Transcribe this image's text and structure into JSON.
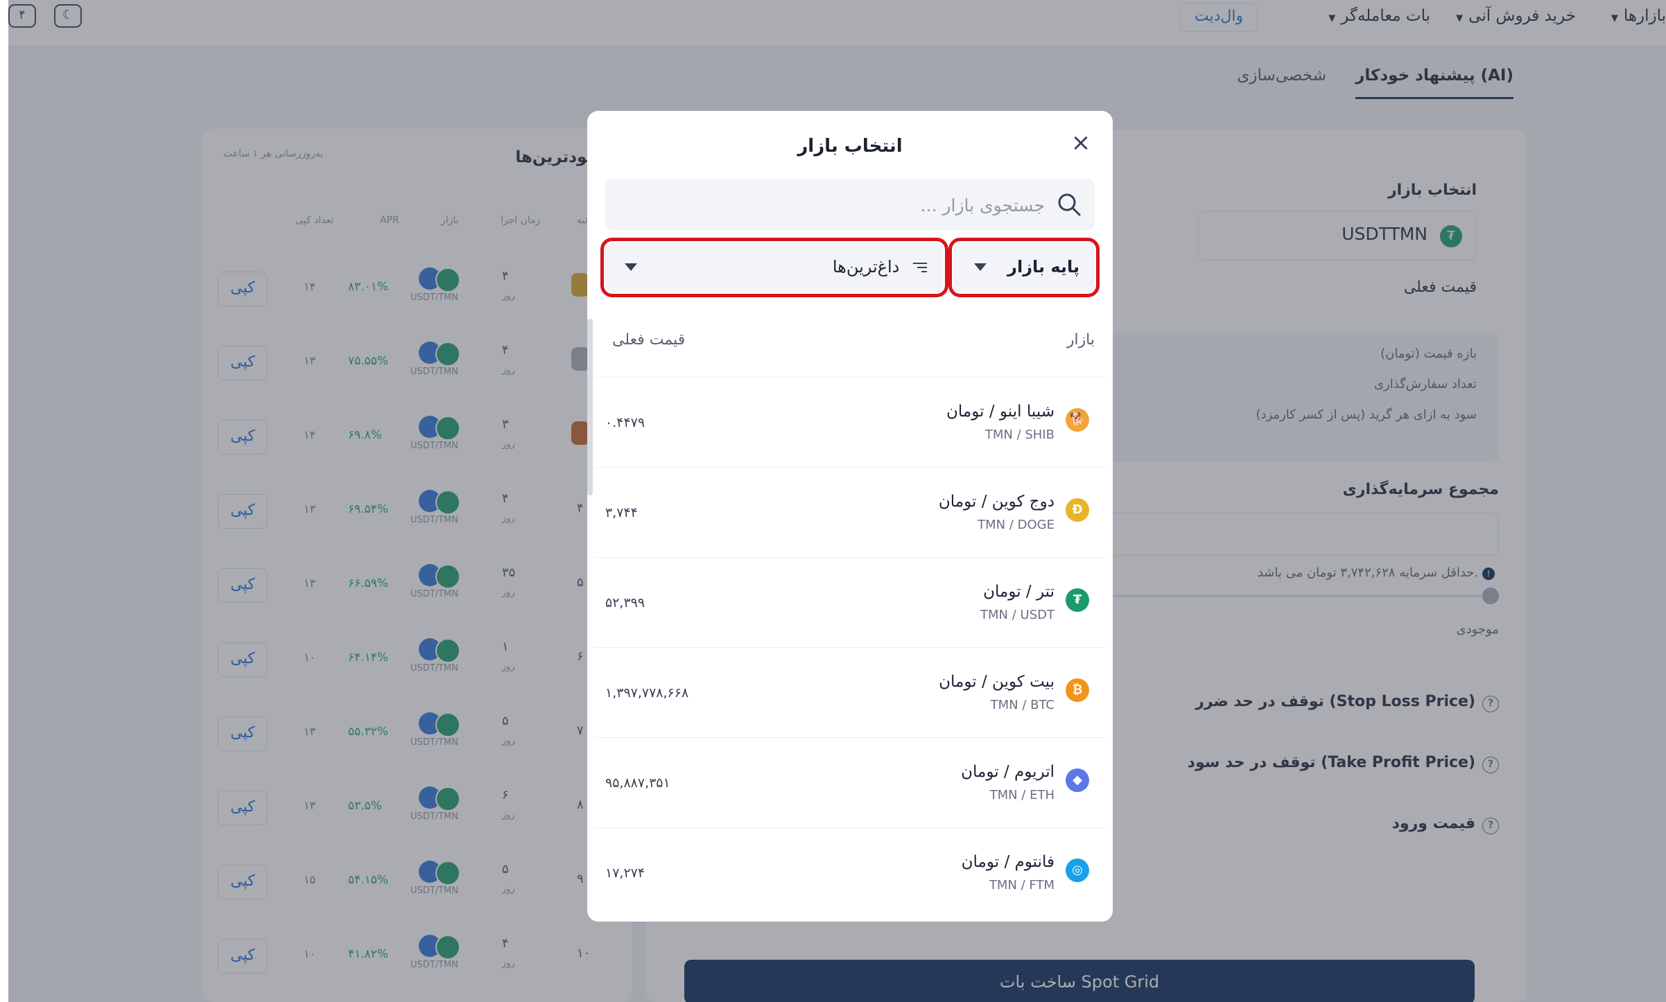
{
  "topnav": {
    "markets": "بازارها",
    "instant_trade": "خرید فروش آنی",
    "trading_bot": "بات معامله‌گر",
    "update": "وال‌دیت"
  },
  "tabs": {
    "ai": "پیشنهاد خودکار (AI)",
    "custom": "شخصی‌سازی"
  },
  "leftpanel": {
    "title": "پرسودترین‌ها",
    "update_note": "به‌روزرسانی هر ۱ ساعت",
    "headers": {
      "rank": "رتبه",
      "runtime": "زمان اجرا",
      "market": "بازار",
      "apr": "APR",
      "copies": "تعداد کپی"
    },
    "copy_label": "کپی",
    "day_unit": "روز",
    "rows": [
      {
        "rank": "",
        "runtime": "۴",
        "pair": "USDT/TMN",
        "apr": "۸۳.۰۱%",
        "copies": "۱۴"
      },
      {
        "rank": "",
        "runtime": "۴",
        "pair": "USDT/TMN",
        "apr": "۷۵.۵۵%",
        "copies": "۱۳"
      },
      {
        "rank": "",
        "runtime": "۳",
        "pair": "USDT/TMN",
        "apr": "۶۹.۸%",
        "copies": "۱۴"
      },
      {
        "rank": "۴",
        "runtime": "۴",
        "pair": "USDT/TMN",
        "apr": "۶۹.۵۴%",
        "copies": "۱۳"
      },
      {
        "rank": "۵",
        "runtime": "۳۵",
        "pair": "USDT/TMN",
        "apr": "۶۶.۵۹%",
        "copies": "۱۳"
      },
      {
        "rank": "۶",
        "runtime": "۱",
        "pair": "USDT/TMN",
        "apr": "۶۴.۱۴%",
        "copies": "۱۰"
      },
      {
        "rank": "۷",
        "runtime": "۵",
        "pair": "USDT/TMN",
        "apr": "۵۵.۳۲%",
        "copies": "۱۳"
      },
      {
        "rank": "۸",
        "runtime": "۶",
        "pair": "USDT/TMN",
        "apr": "۵۳.۵%",
        "copies": "۱۳"
      },
      {
        "rank": "۹",
        "runtime": "۵",
        "pair": "USDT/TMN",
        "apr": "۵۴.۱۵%",
        "copies": "۱۵"
      },
      {
        "rank": "۱۰",
        "runtime": "۴",
        "pair": "USDT/TMN",
        "apr": "۴۱.۸۲%",
        "copies": "۱۰"
      }
    ]
  },
  "form": {
    "select_market": "انتخاب بازار",
    "selected_market": "USDTTMN",
    "current_price": "قیمت فعلی",
    "price_range": "بازه قیمت (تومان)",
    "order_count": "تعداد سفارش‌گذاری",
    "profit_per_grid": "سود به ازای هر گرید (پس از کسر کارمزد)",
    "total_investment": "مجموع سرمایه‌گذاری",
    "min_capital_note": "حداقل سرمایه ۳,۷۴۲,۶۲۸ تومان می باشد.",
    "balance": "موجودی",
    "stop_loss": "توقف در حد ضرر (Stop Loss Price)",
    "take_profit": "توقف در حد سود (Take Profit Price)",
    "entry_price": "قیمت ورود",
    "create_button": "ساخت بات Spot Grid"
  },
  "modal": {
    "title": "انتخاب بازار",
    "search_placeholder": "جستجوی بازار ...",
    "base_market": "پایه بازار",
    "hottest": "داغ‌ترین‌ها",
    "col_market": "بازار",
    "col_price": "قیمت فعلی",
    "items": [
      {
        "name": "شیبا اینو / تومان",
        "pair": "TMN / SHIB",
        "price": "۰.۴۴۷۹",
        "icon": "shib-icon",
        "color": "#f2a33c"
      },
      {
        "name": "دوج کوین / تومان",
        "pair": "TMN / DOGE",
        "price": "۳,۷۴۴",
        "icon": "doge-icon",
        "color": "#e9b428"
      },
      {
        "name": "تتر / تومان",
        "pair": "TMN / USDT",
        "price": "۵۲,۳۹۹",
        "icon": "usdt-icon",
        "color": "#1b9b6a"
      },
      {
        "name": "بیت کوین / تومان",
        "pair": "TMN / BTC",
        "price": "۱,۳۹۷,۷۷۸,۶۶۸",
        "icon": "btc-icon",
        "color": "#f2941a"
      },
      {
        "name": "اتریوم / تومان",
        "pair": "TMN / ETH",
        "price": "۹۵,۸۸۷,۳۵۱",
        "icon": "eth-icon",
        "color": "#5b78e6"
      },
      {
        "name": "فانتوم / تومان",
        "pair": "TMN / FTM",
        "price": "۱۷,۲۷۴",
        "icon": "ftm-icon",
        "color": "#1a9fe8"
      }
    ]
  },
  "colors": {
    "brand_dark": "#0c2a5c",
    "highlight": "#d6151b",
    "accent_blue": "#1a6bd8"
  }
}
